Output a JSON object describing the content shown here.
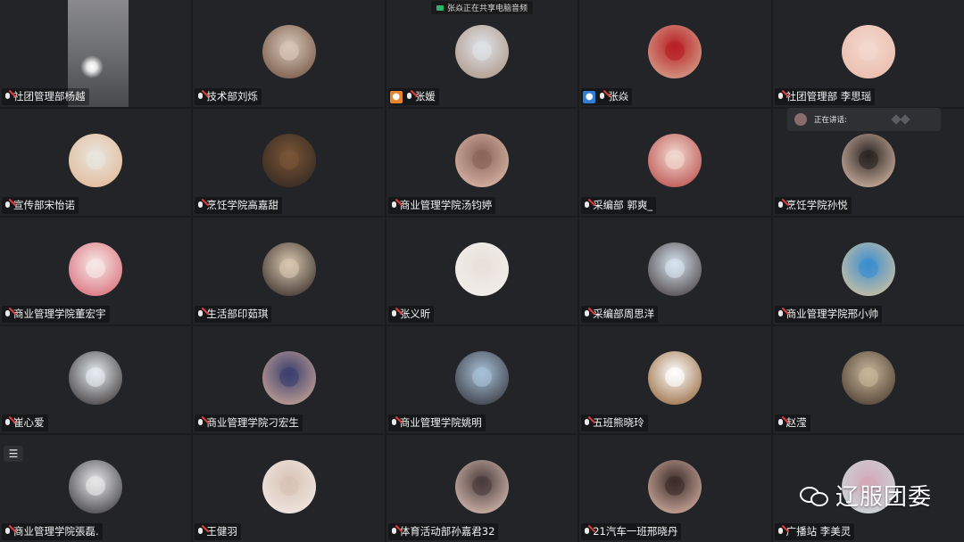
{
  "share_banner": "张焱正在共享电脑音频",
  "speaking_label": "正在讲话:",
  "watermark": "辽服团委",
  "tiles": [
    {
      "name": "社团管理部杨越",
      "avatar": "video",
      "colors": [
        "#7a7b7d",
        "#d9c7b6"
      ]
    },
    {
      "name": "技术部刘烁",
      "colors": [
        "#d8c8b8",
        "#6b4a3a"
      ]
    },
    {
      "name": "张媛",
      "badge": "orange",
      "colors": [
        "#dfe3e8",
        "#a98f7e"
      ]
    },
    {
      "name": "张焱",
      "badge": "blue",
      "colors": [
        "#b81f24",
        "#d9b39a"
      ]
    },
    {
      "name": "社团管理部 李思瑶",
      "colors": [
        "#f4d9cf",
        "#e8b8a8"
      ]
    },
    {
      "name": "宣传部宋怡诺",
      "colors": [
        "#e9e6df",
        "#e0b48f"
      ]
    },
    {
      "name": "烹饪学院高嘉甜",
      "colors": [
        "#7a5536",
        "#2b2320"
      ]
    },
    {
      "name": "商业管理学院汤钧婷",
      "colors": [
        "#8a6258",
        "#e3c2b2"
      ]
    },
    {
      "name": "采编部 郭爽_",
      "colors": [
        "#f1d9d0",
        "#b5413f"
      ]
    },
    {
      "name": "烹饪学院孙悦",
      "colors": [
        "#2a2522",
        "#e7c6b4"
      ]
    },
    {
      "name": "商业管理学院董宏宇",
      "colors": [
        "#f6eae6",
        "#d65f6e"
      ]
    },
    {
      "name": "生活部印茹琪",
      "colors": [
        "#d9c7b0",
        "#2a211e"
      ]
    },
    {
      "name": "张义昕",
      "colors": [
        "#e8e1db",
        "#f3f0ec"
      ]
    },
    {
      "name": "采编部周思洋",
      "colors": [
        "#d7e4f0",
        "#3a3030"
      ]
    },
    {
      "name": "商业管理学院邢小帅",
      "colors": [
        "#3a8ed1",
        "#e6c89a"
      ]
    },
    {
      "name": "崔心爱",
      "colors": [
        "#e6ecf1",
        "#2b2524"
      ]
    },
    {
      "name": "商业管理学院刁宏生",
      "colors": [
        "#3a3f6e",
        "#d9b09a"
      ]
    },
    {
      "name": "商业管理学院姚明",
      "colors": [
        "#a9c1d8",
        "#2a2a30"
      ]
    },
    {
      "name": "五班熊晓玲",
      "colors": [
        "#ffffff",
        "#8c5a2b"
      ]
    },
    {
      "name": "赵滢",
      "colors": [
        "#c7b89a",
        "#3f2f26"
      ]
    },
    {
      "name": "商业管理学院張磊.",
      "colors": [
        "#e9e9ea",
        "#2c2b2e"
      ]
    },
    {
      "name": "王健羽",
      "colors": [
        "#d8c2b5",
        "#f4ede8"
      ]
    },
    {
      "name": "体育活动部孙嘉君32",
      "colors": [
        "#4a3b3a",
        "#e8ccc0"
      ]
    },
    {
      "name": "21汽车一班邢晓丹",
      "colors": [
        "#3a2b28",
        "#e6bfb0"
      ]
    },
    {
      "name": "广播站 李美灵",
      "colors": [
        "#d3a9b6",
        "#c9dde0"
      ]
    }
  ]
}
